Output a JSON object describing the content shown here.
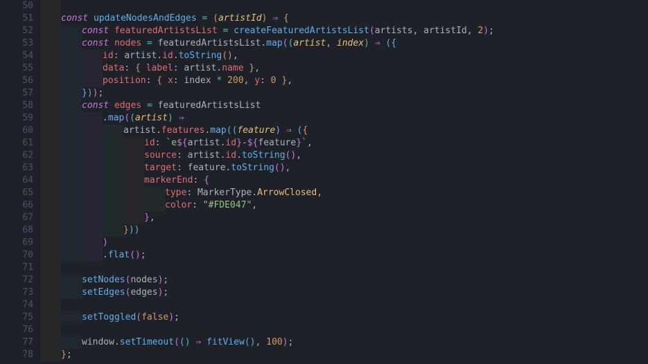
{
  "editor": {
    "firstLine": 50,
    "lastLine": 78
  },
  "code": {
    "l51_kw": "const",
    "l51_fn": "updateNodesAndEdges",
    "l51_eq": " = ",
    "l51_p": "artistId",
    "l51_arrow": " ⇒ ",
    "l52_kw": "const",
    "l52_var": "featuredArtistsList",
    "l52_fn": "createFeaturedArtistsList",
    "l52_a1": "artists",
    "l52_a2": "artistId",
    "l52_a3": "2",
    "l53_kw": "const",
    "l53_var": "nodes",
    "l53_src": "featuredArtistsList",
    "l53_map": "map",
    "l53_p1": "artist",
    "l53_p2": "index",
    "l54_key": "id",
    "l54_v1": "artist",
    "l54_v2": "id",
    "l54_v3": "toString",
    "l55_key": "data",
    "l55_lab": "label",
    "l55_v1": "artist",
    "l55_v2": "name",
    "l56_key": "position",
    "l56_x": "x",
    "l56_xv1": "index",
    "l56_xv2": "200",
    "l56_y": "y",
    "l56_yv": "0",
    "l58_kw": "const",
    "l58_var": "edges",
    "l58_src": "featuredArtistsList",
    "l59_map": "map",
    "l59_p": "artist",
    "l60_a": "artist",
    "l60_f": "features",
    "l60_m": "map",
    "l60_p": "feature",
    "l61_key": "id",
    "l61_tpl_open": "`e",
    "l61_tpl_a1": "artist",
    "l61_tpl_a2": "id",
    "l61_tpl_mid": "-",
    "l61_tpl_b": "feature",
    "l61_tpl_close": "`",
    "l62_key": "source",
    "l62_a": "artist",
    "l62_b": "id",
    "l62_c": "toString",
    "l63_key": "target",
    "l63_a": "feature",
    "l63_b": "toString",
    "l64_key": "markerEnd",
    "l65_key": "type",
    "l65_a": "MarkerType",
    "l65_b": "ArrowClosed",
    "l66_key": "color",
    "l66_str": "\"#FDE047\"",
    "l70_flat": "flat",
    "l72_fn": "setNodes",
    "l72_arg": "nodes",
    "l73_fn": "setEdges",
    "l73_arg": "edges",
    "l75_fn": "setToggled",
    "l75_arg": "false",
    "l77_w": "window",
    "l77_st": "setTimeout",
    "l77_fv": "fitView",
    "l77_ms": "100"
  }
}
